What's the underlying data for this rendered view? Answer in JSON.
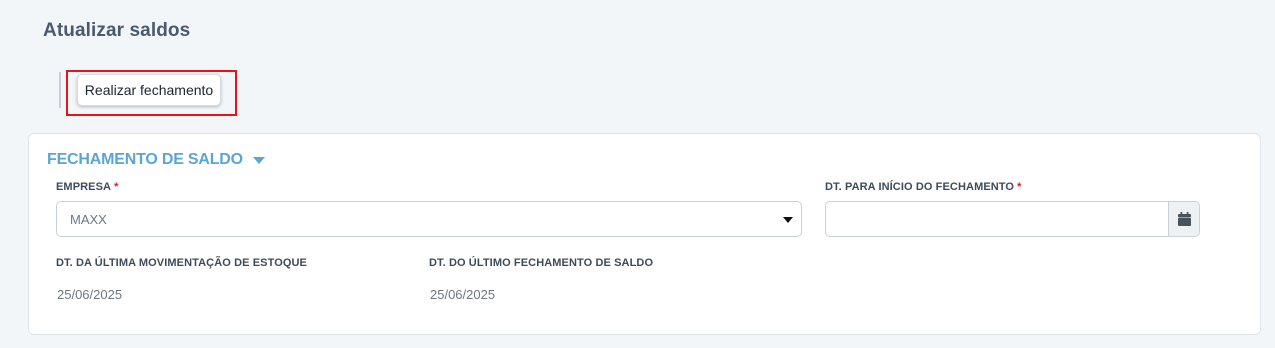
{
  "page": {
    "title": "Atualizar saldos"
  },
  "toolbar": {
    "close_balance_label": "Realizar fechamento"
  },
  "section": {
    "title": "FECHAMENTO DE SALDO"
  },
  "fields": {
    "empresa": {
      "label": "EMPRESA",
      "required": "*",
      "value": "MAXX"
    },
    "start_date": {
      "label": "DT. PARA INÍCIO DO FECHAMENTO",
      "required": "*",
      "value": ""
    },
    "last_stock_movement": {
      "label": "DT. DA ÚLTIMA MOVIMENTAÇÃO DE ESTOQUE",
      "value": "25/06/2025"
    },
    "last_balance_close": {
      "label": "DT. DO ÚLTIMO FECHAMENTO DE SALDO",
      "value": "25/06/2025"
    }
  },
  "icons": {
    "section_toggle": "caret-down-icon",
    "select_toggle": "caret-down-icon",
    "date_picker": "calendar-icon"
  },
  "colors": {
    "accent": "#5aa6d2",
    "required": "#e3141a",
    "highlight": "#e3141a",
    "background": "#f3f6f9"
  }
}
